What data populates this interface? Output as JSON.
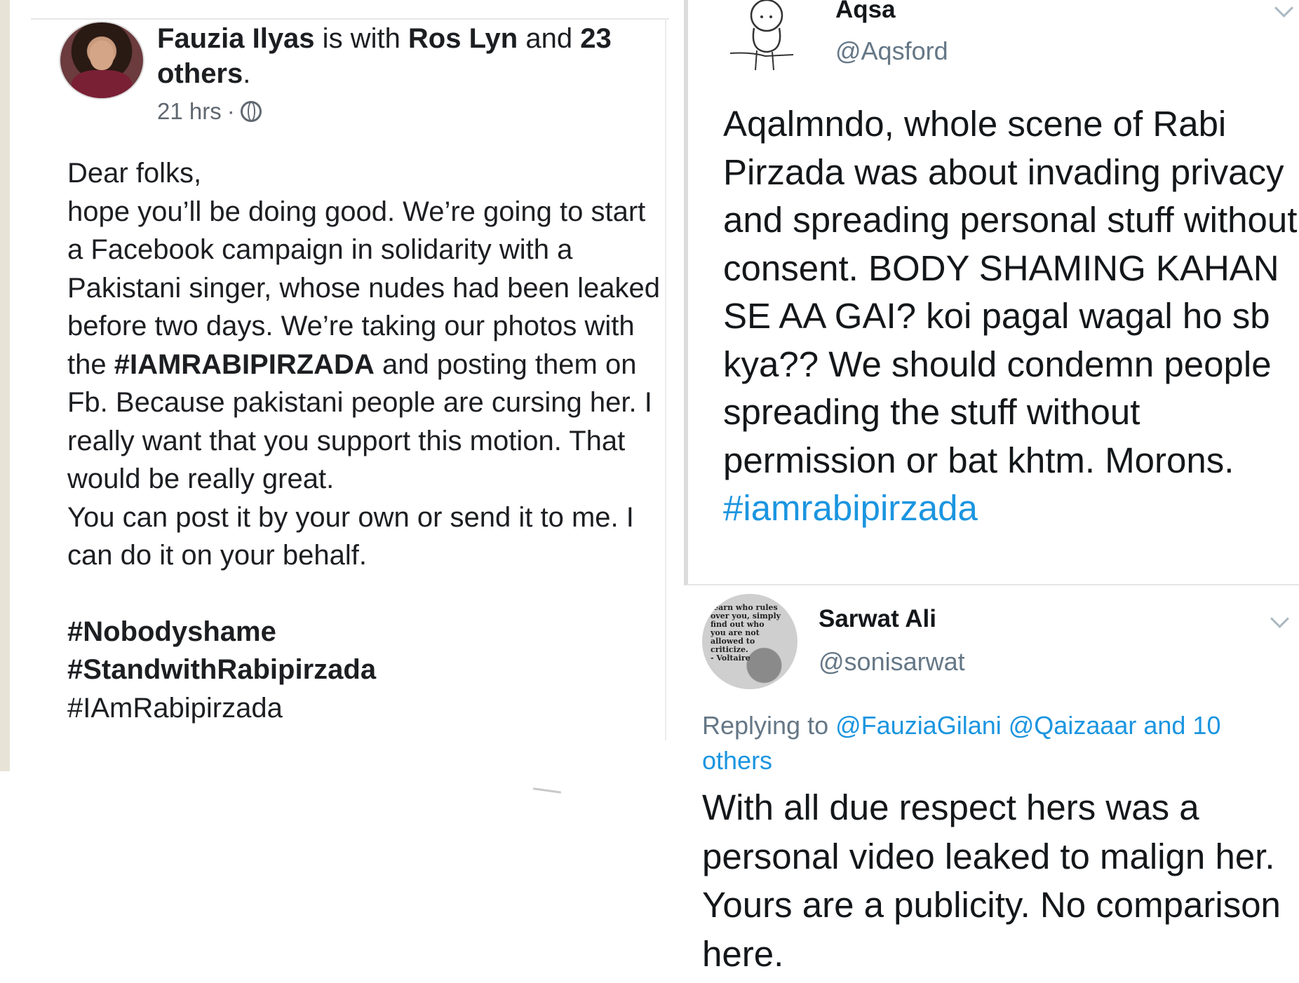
{
  "facebook_post": {
    "author": "Fauzia Ilyas",
    "with_text": " is with ",
    "tagged": "Ros Lyn",
    "and_text": " and ",
    "others_count": "23",
    "others_label": "others",
    "time": "21 hrs",
    "separator": "·",
    "body": {
      "greeting": "Dear folks,",
      "line1": "hope you’ll be doing good. We’re going to start a Facebook campaign in solidarity with a Pakistani singer, whose nudes had been leaked before two days. We’re taking our photos with the ",
      "hashtag_inline": "#IAMRABIPIRZADA",
      "line2": " and posting them on Fb. Because pakistani people are cursing her. I really want that you support this motion. That would be really great.",
      "line3": "You can post it by your own or send it to me. I can do it on your behalf."
    },
    "hashtags": [
      "#Nobodyshame",
      "#StandwithRabipirzada",
      "#IAmRabipirzada"
    ]
  },
  "tweet_aqsa": {
    "name": "Aqsa",
    "handle": "@Aqsford",
    "text": "Aqalmndo, whole scene of Rabi Pirzada was about invading privacy and spreading personal stuff without consent. BODY SHAMING KAHAN SE AA GAI? koi pagal wagal ho sb kya?? We should condemn people spreading the stuff without permission or bat khtm. Morons.",
    "hashtag": "#iamrabipirzada"
  },
  "tweet_sarwat": {
    "name": "Sarwat Ali",
    "handle": "@sonisarwat",
    "replying_label": "Replying to ",
    "replying_mentions": "@FauziaGilani @Qaizaaar and 10 others",
    "text": "With all due respect hers was a personal video leaked to malign her. Yours are a publicity. No comparison here.",
    "avatar_quote": "learn who rules over you, simply find out who you are not allowed to criticize.",
    "avatar_quote_author": "- Voltaire"
  },
  "colors": {
    "link_blue": "#1b95e0",
    "muted_gray": "#657786",
    "fb_text": "#1c1e21"
  }
}
